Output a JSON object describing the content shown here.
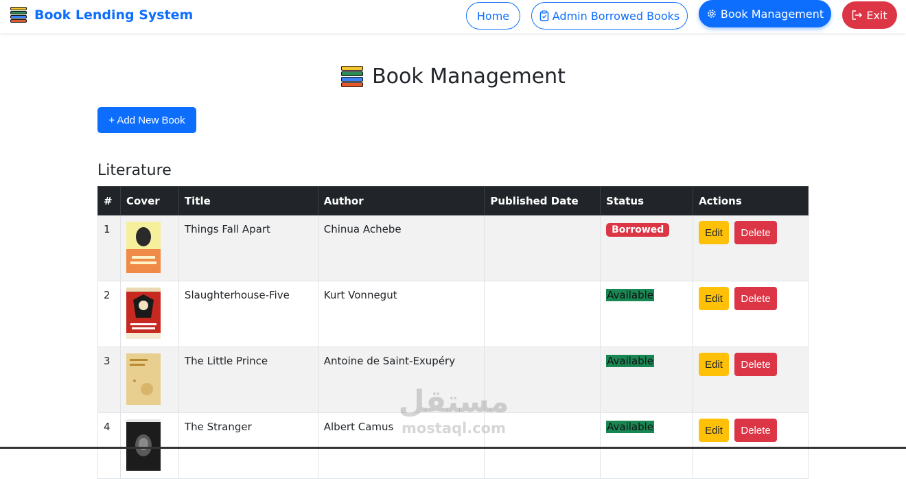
{
  "navbar": {
    "brand": "Book Lending System",
    "brand_icon": "books-stack-icon",
    "home_label": "Home",
    "admin_borrowed_label": "Admin Borrowed Books",
    "book_management_label": "Book Management",
    "exit_label": "Exit"
  },
  "page": {
    "title": "Book Management",
    "add_button_label": "+ Add New Book",
    "section_title": "Literature"
  },
  "table": {
    "headers": [
      "#",
      "Cover",
      "Title",
      "Author",
      "Published Date",
      "Status",
      "Actions"
    ],
    "rows": [
      {
        "num": "1",
        "title": "Things Fall Apart",
        "author": "Chinua Achebe",
        "published": "",
        "status": "Borrowed",
        "edit": "Edit",
        "delete": "Delete"
      },
      {
        "num": "2",
        "title": "Slaughterhouse-Five",
        "author": "Kurt Vonnegut",
        "published": "",
        "status": "Available",
        "edit": "Edit",
        "delete": "Delete"
      },
      {
        "num": "3",
        "title": "The Little Prince",
        "author": "Antoine de Saint-Exupéry",
        "published": "",
        "status": "Available",
        "edit": "Edit",
        "delete": "Delete"
      },
      {
        "num": "4",
        "title": "The Stranger",
        "author": "Albert Camus",
        "published": "",
        "status": "Available",
        "edit": "Edit",
        "delete": "Delete"
      }
    ]
  },
  "watermark": {
    "arabic": "مستقل",
    "latin": "mostaql.com"
  },
  "colors": {
    "primary": "#0d6efd",
    "danger": "#dc3545",
    "warning": "#ffc107",
    "success": "#198754",
    "dark": "#212529"
  }
}
